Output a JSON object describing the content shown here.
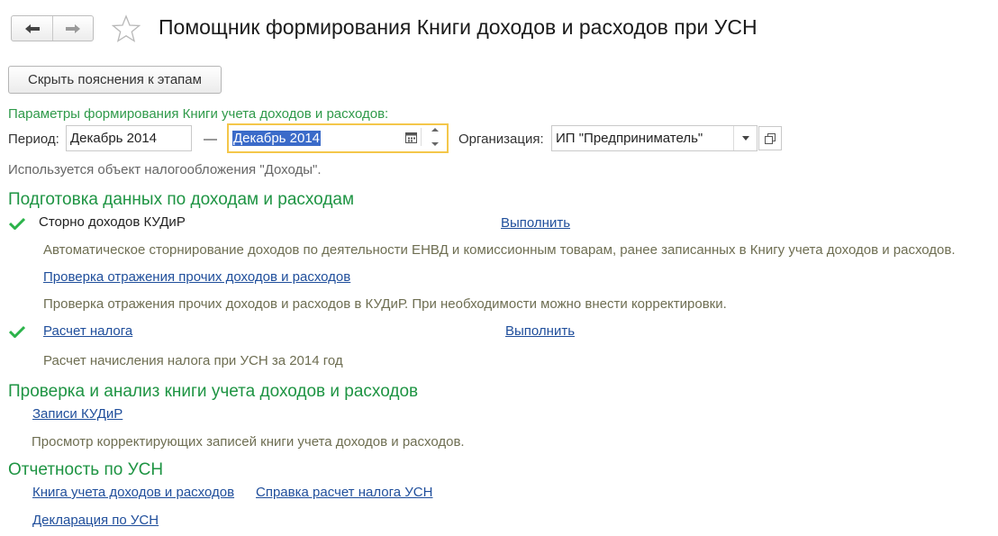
{
  "header": {
    "title": "Помощник формирования Книги доходов и расходов при УСН"
  },
  "toolbar": {
    "hide_label": "Скрыть пояснения к этапам"
  },
  "params": {
    "caption": "Параметры формирования Книги учета доходов и расходов:",
    "period_label": "Период:",
    "period_from": "Декабрь 2014",
    "dash": "—",
    "period_to": "Декабрь 2014",
    "org_label": "Организация:",
    "org_value": "ИП \"Предприниматель\"",
    "tax_object_note": "Используется объект налогообложения \"Доходы\"."
  },
  "section1": {
    "heading": "Подготовка данных по доходам и расходам",
    "step1_label": "Сторно доходов КУДиР",
    "step1_action": "Выполнить",
    "step1_desc": "Автоматическое сторнирование доходов по деятельности ЕНВД и комиссионным товарам, ранее записанных в Книгу учета доходов и расходов.",
    "step2_link": "Проверка отражения прочих доходов и расходов",
    "step2_desc": "Проверка отражения прочих доходов и расходов в КУДиР. При необходимости можно внести корректировки.",
    "step3_link": "Расчет налога",
    "step3_action": "Выполнить",
    "step3_desc": "Расчет начисления налога при УСН за 2014 год"
  },
  "section2": {
    "heading": "Проверка и анализ книги учета доходов и расходов",
    "link": "Записи КУДиР",
    "desc": "Просмотр корректирующих записей книги учета доходов и расходов."
  },
  "section3": {
    "heading": "Отчетность по УСН",
    "link1": "Книга учета доходов и расходов",
    "link2": "Справка расчет налога УСН",
    "link3": "Декларация по УСН"
  },
  "colors": {
    "heading_green": "#1e9443",
    "link_blue": "#1f4e9b",
    "check_green": "#2bb34a",
    "active_border": "#f4c74a"
  },
  "icons": [
    "back-arrow-icon",
    "forward-arrow-icon",
    "favorite-star-icon",
    "calendar-icon",
    "spin-up-icon",
    "spin-down-icon",
    "dropdown-icon",
    "open-icon",
    "checkmark-icon"
  ]
}
